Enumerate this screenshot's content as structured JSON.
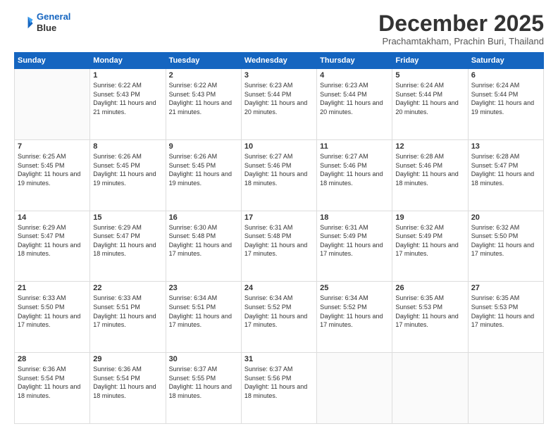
{
  "logo": {
    "line1": "General",
    "line2": "Blue"
  },
  "header": {
    "month": "December 2025",
    "location": "Prachamtakham, Prachin Buri, Thailand"
  },
  "weekdays": [
    "Sunday",
    "Monday",
    "Tuesday",
    "Wednesday",
    "Thursday",
    "Friday",
    "Saturday"
  ],
  "weeks": [
    [
      {
        "day": "",
        "empty": true
      },
      {
        "day": "1",
        "sunrise": "Sunrise: 6:22 AM",
        "sunset": "Sunset: 5:43 PM",
        "daylight": "Daylight: 11 hours and 21 minutes."
      },
      {
        "day": "2",
        "sunrise": "Sunrise: 6:22 AM",
        "sunset": "Sunset: 5:43 PM",
        "daylight": "Daylight: 11 hours and 21 minutes."
      },
      {
        "day": "3",
        "sunrise": "Sunrise: 6:23 AM",
        "sunset": "Sunset: 5:44 PM",
        "daylight": "Daylight: 11 hours and 20 minutes."
      },
      {
        "day": "4",
        "sunrise": "Sunrise: 6:23 AM",
        "sunset": "Sunset: 5:44 PM",
        "daylight": "Daylight: 11 hours and 20 minutes."
      },
      {
        "day": "5",
        "sunrise": "Sunrise: 6:24 AM",
        "sunset": "Sunset: 5:44 PM",
        "daylight": "Daylight: 11 hours and 20 minutes."
      },
      {
        "day": "6",
        "sunrise": "Sunrise: 6:24 AM",
        "sunset": "Sunset: 5:44 PM",
        "daylight": "Daylight: 11 hours and 19 minutes."
      }
    ],
    [
      {
        "day": "7",
        "sunrise": "Sunrise: 6:25 AM",
        "sunset": "Sunset: 5:45 PM",
        "daylight": "Daylight: 11 hours and 19 minutes."
      },
      {
        "day": "8",
        "sunrise": "Sunrise: 6:26 AM",
        "sunset": "Sunset: 5:45 PM",
        "daylight": "Daylight: 11 hours and 19 minutes."
      },
      {
        "day": "9",
        "sunrise": "Sunrise: 6:26 AM",
        "sunset": "Sunset: 5:45 PM",
        "daylight": "Daylight: 11 hours and 19 minutes."
      },
      {
        "day": "10",
        "sunrise": "Sunrise: 6:27 AM",
        "sunset": "Sunset: 5:46 PM",
        "daylight": "Daylight: 11 hours and 18 minutes."
      },
      {
        "day": "11",
        "sunrise": "Sunrise: 6:27 AM",
        "sunset": "Sunset: 5:46 PM",
        "daylight": "Daylight: 11 hours and 18 minutes."
      },
      {
        "day": "12",
        "sunrise": "Sunrise: 6:28 AM",
        "sunset": "Sunset: 5:46 PM",
        "daylight": "Daylight: 11 hours and 18 minutes."
      },
      {
        "day": "13",
        "sunrise": "Sunrise: 6:28 AM",
        "sunset": "Sunset: 5:47 PM",
        "daylight": "Daylight: 11 hours and 18 minutes."
      }
    ],
    [
      {
        "day": "14",
        "sunrise": "Sunrise: 6:29 AM",
        "sunset": "Sunset: 5:47 PM",
        "daylight": "Daylight: 11 hours and 18 minutes."
      },
      {
        "day": "15",
        "sunrise": "Sunrise: 6:29 AM",
        "sunset": "Sunset: 5:47 PM",
        "daylight": "Daylight: 11 hours and 18 minutes."
      },
      {
        "day": "16",
        "sunrise": "Sunrise: 6:30 AM",
        "sunset": "Sunset: 5:48 PM",
        "daylight": "Daylight: 11 hours and 17 minutes."
      },
      {
        "day": "17",
        "sunrise": "Sunrise: 6:31 AM",
        "sunset": "Sunset: 5:48 PM",
        "daylight": "Daylight: 11 hours and 17 minutes."
      },
      {
        "day": "18",
        "sunrise": "Sunrise: 6:31 AM",
        "sunset": "Sunset: 5:49 PM",
        "daylight": "Daylight: 11 hours and 17 minutes."
      },
      {
        "day": "19",
        "sunrise": "Sunrise: 6:32 AM",
        "sunset": "Sunset: 5:49 PM",
        "daylight": "Daylight: 11 hours and 17 minutes."
      },
      {
        "day": "20",
        "sunrise": "Sunrise: 6:32 AM",
        "sunset": "Sunset: 5:50 PM",
        "daylight": "Daylight: 11 hours and 17 minutes."
      }
    ],
    [
      {
        "day": "21",
        "sunrise": "Sunrise: 6:33 AM",
        "sunset": "Sunset: 5:50 PM",
        "daylight": "Daylight: 11 hours and 17 minutes."
      },
      {
        "day": "22",
        "sunrise": "Sunrise: 6:33 AM",
        "sunset": "Sunset: 5:51 PM",
        "daylight": "Daylight: 11 hours and 17 minutes."
      },
      {
        "day": "23",
        "sunrise": "Sunrise: 6:34 AM",
        "sunset": "Sunset: 5:51 PM",
        "daylight": "Daylight: 11 hours and 17 minutes."
      },
      {
        "day": "24",
        "sunrise": "Sunrise: 6:34 AM",
        "sunset": "Sunset: 5:52 PM",
        "daylight": "Daylight: 11 hours and 17 minutes."
      },
      {
        "day": "25",
        "sunrise": "Sunrise: 6:34 AM",
        "sunset": "Sunset: 5:52 PM",
        "daylight": "Daylight: 11 hours and 17 minutes."
      },
      {
        "day": "26",
        "sunrise": "Sunrise: 6:35 AM",
        "sunset": "Sunset: 5:53 PM",
        "daylight": "Daylight: 11 hours and 17 minutes."
      },
      {
        "day": "27",
        "sunrise": "Sunrise: 6:35 AM",
        "sunset": "Sunset: 5:53 PM",
        "daylight": "Daylight: 11 hours and 17 minutes."
      }
    ],
    [
      {
        "day": "28",
        "sunrise": "Sunrise: 6:36 AM",
        "sunset": "Sunset: 5:54 PM",
        "daylight": "Daylight: 11 hours and 18 minutes."
      },
      {
        "day": "29",
        "sunrise": "Sunrise: 6:36 AM",
        "sunset": "Sunset: 5:54 PM",
        "daylight": "Daylight: 11 hours and 18 minutes."
      },
      {
        "day": "30",
        "sunrise": "Sunrise: 6:37 AM",
        "sunset": "Sunset: 5:55 PM",
        "daylight": "Daylight: 11 hours and 18 minutes."
      },
      {
        "day": "31",
        "sunrise": "Sunrise: 6:37 AM",
        "sunset": "Sunset: 5:56 PM",
        "daylight": "Daylight: 11 hours and 18 minutes."
      },
      {
        "day": "",
        "empty": true
      },
      {
        "day": "",
        "empty": true
      },
      {
        "day": "",
        "empty": true
      }
    ]
  ]
}
